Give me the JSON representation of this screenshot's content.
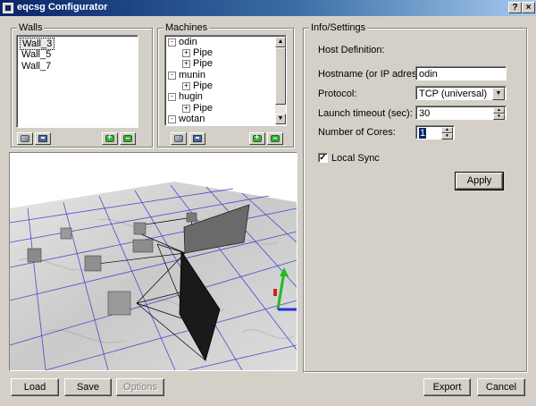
{
  "window": {
    "title": "eqcsg Configurator",
    "help_label": "?",
    "close_label": "×"
  },
  "walls": {
    "group_label": "Walls",
    "items": [
      {
        "label": "Wall_3",
        "selected": true
      },
      {
        "label": "Wall_5"
      },
      {
        "label": "Wall_7"
      }
    ],
    "tools": {
      "open_icon": "open-icon",
      "save_icon": "save-icon",
      "add_icon": "add-icon",
      "remove_icon": "remove-icon"
    }
  },
  "machines": {
    "group_label": "Machines",
    "tree": [
      {
        "label": "odin",
        "expander": "-",
        "level": 0
      },
      {
        "label": "Pipe",
        "expander": "+",
        "level": 1
      },
      {
        "label": "Pipe",
        "expander": "+",
        "level": 1
      },
      {
        "label": "munin",
        "expander": "-",
        "level": 0
      },
      {
        "label": "Pipe",
        "expander": "+",
        "level": 1
      },
      {
        "label": "hugin",
        "expander": "-",
        "level": 0
      },
      {
        "label": "Pipe",
        "expander": "+",
        "level": 1
      },
      {
        "label": "wotan",
        "expander": "-",
        "level": 0
      }
    ],
    "scroll_up_glyph": "▲",
    "scroll_down_glyph": "▼"
  },
  "settings": {
    "group_label": "Info/Settings",
    "host_definition_label": "Host Definition:",
    "hostname_label": "Hostname (or IP adress)",
    "hostname_value": "odin",
    "protocol_label": "Protocol:",
    "protocol_value": "TCP (universal)",
    "launch_timeout_label": "Launch timeout (sec):",
    "launch_timeout_value": "30",
    "cores_label": "Number of Cores:",
    "cores_value": "1",
    "local_sync_label": "Local Sync",
    "local_sync_checked": true,
    "apply_label": "Apply"
  },
  "viewport": {
    "description_icon": "3d-scene"
  },
  "bottom": {
    "load_label": "Load",
    "save_label": "Save",
    "options_label": "Options",
    "export_label": "Export",
    "cancel_label": "Cancel"
  },
  "colors": {
    "titlebar_start": "#0a246a",
    "titlebar_end": "#a6caf0",
    "face": "#d4d0c8",
    "grid_lines": "#3333cc"
  }
}
